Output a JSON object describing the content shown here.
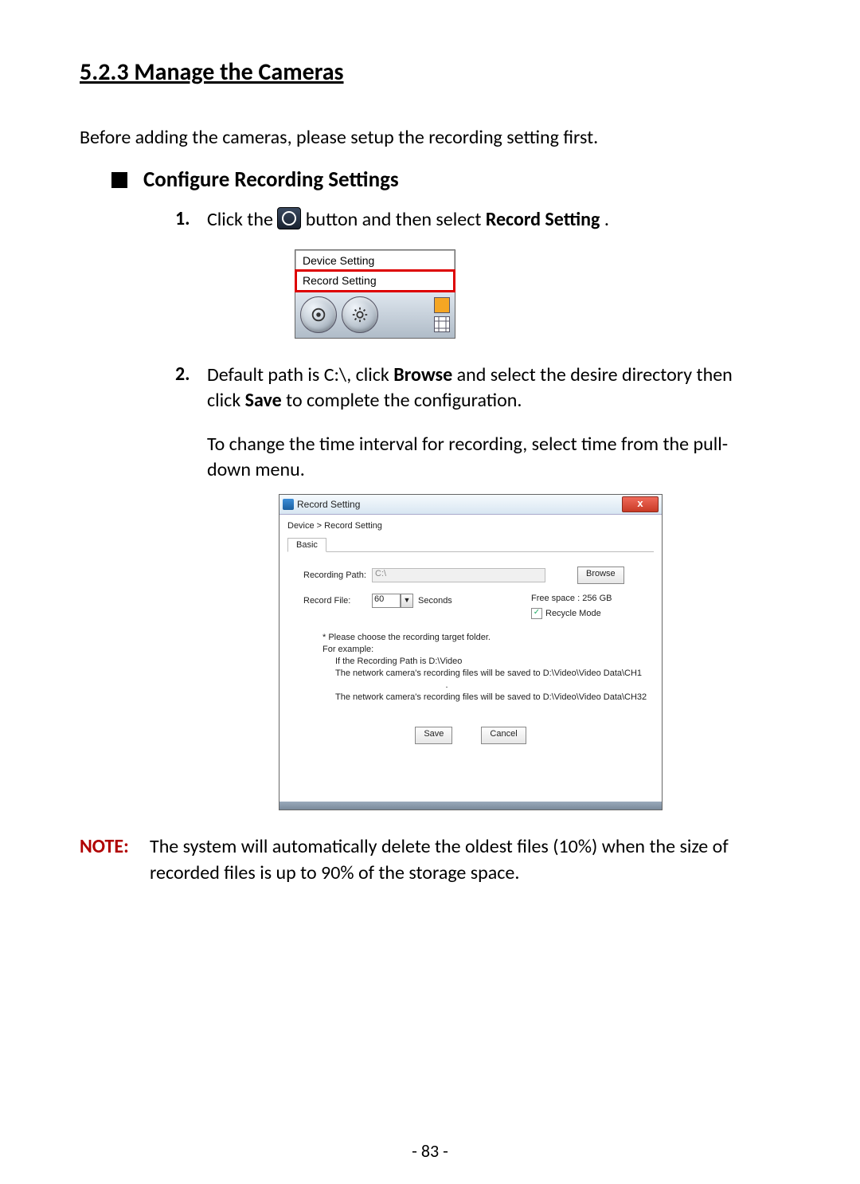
{
  "heading": "5.2.3 Manage the Cameras",
  "intro": "Before adding the cameras, please setup the recording setting first.",
  "subheading": "Configure Recording Settings",
  "steps": {
    "s1": {
      "num": "1.",
      "pre": "Click the ",
      "post": " button and then select ",
      "bold": "Record Setting",
      "tail": "."
    },
    "s2": {
      "num": "2.",
      "line1_pre": "Default path is C:\\, click ",
      "line1_b1": "Browse",
      "line1_mid": " and select the desire directory then click ",
      "line1_b2": "Save",
      "line1_post": " to complete the configuration.",
      "para2": "To change the time interval for recording, select time from the pull-down menu."
    }
  },
  "menu_fig": {
    "items": [
      "Device Setting",
      "Record Setting"
    ]
  },
  "dialog": {
    "title": "Record Setting",
    "close": "x",
    "breadcrumb": "Device > Record Setting",
    "tab": "Basic",
    "labels": {
      "recording_path": "Recording Path:",
      "record_file": "Record File:",
      "seconds": "Seconds",
      "free_space": "Free space : 256 GB",
      "recycle": "Recycle Mode"
    },
    "values": {
      "path": "C:\\",
      "interval": "60"
    },
    "buttons": {
      "browse": "Browse",
      "save": "Save",
      "cancel": "Cancel"
    },
    "help": {
      "l1": "* Please choose the recording target folder.",
      "l2": "For example:",
      "l3": "If the Recording Path is D:\\Video",
      "l4": "The network camera's recording files will be saved to D:\\Video\\Video Data\\CH1",
      "dots": ".",
      "l5": "The network camera's recording files will be saved to D:\\Video\\Video Data\\CH32"
    }
  },
  "note": {
    "label": "NOTE:",
    "text": "The system will automatically delete the oldest files (10%) when the size of recorded files is up to 90% of the storage space."
  },
  "page_number": "- 83 -"
}
